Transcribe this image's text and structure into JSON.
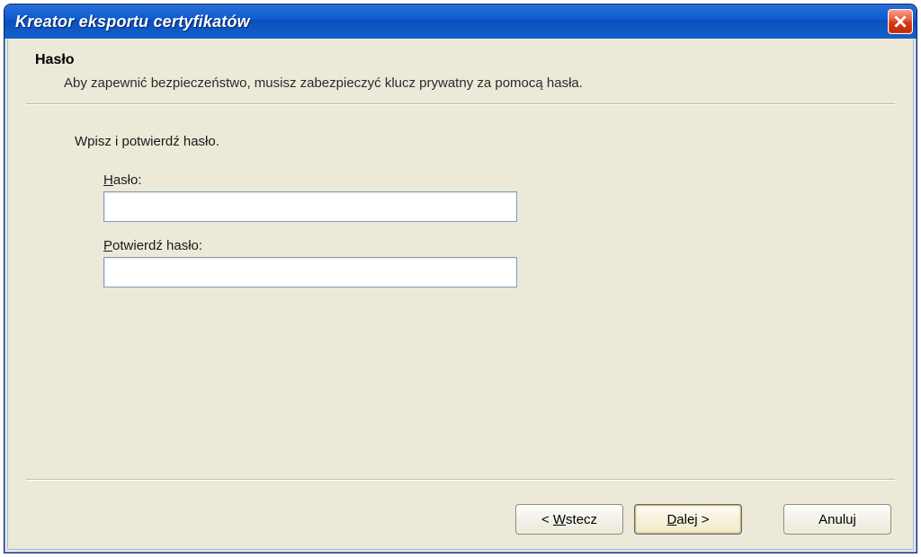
{
  "window": {
    "title": "Kreator eksportu certyfikatów"
  },
  "header": {
    "title": "Hasło",
    "description": "Aby zapewnić bezpieczeństwo, musisz zabezpieczyć klucz prywatny za pomocą hasła."
  },
  "body": {
    "instruction": "Wpisz i potwierdź hasło.",
    "password": {
      "label_prefix": "H",
      "label_rest": "asło:",
      "value": ""
    },
    "confirm": {
      "label_prefix": "P",
      "label_rest": "otwierdź hasło:",
      "value": ""
    }
  },
  "footer": {
    "back_prefix": "< ",
    "back_ul": "W",
    "back_rest": "stecz",
    "next_ul": "D",
    "next_rest": "alej >",
    "cancel": "Anuluj"
  }
}
